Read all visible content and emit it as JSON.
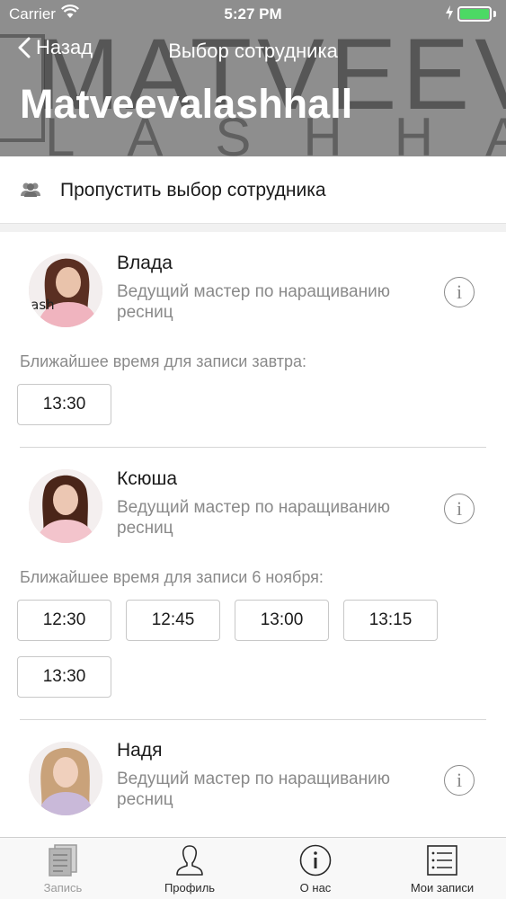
{
  "status_bar": {
    "carrier": "Carrier",
    "time": "5:27 PM"
  },
  "header": {
    "back_label": "Назад",
    "nav_title": "Выбор сотрудника",
    "title": "Matveevalashhall",
    "bg_logo_line1": "MATVEEV",
    "bg_logo_line2": "LASHHA"
  },
  "skip": {
    "label": "Пропустить выбор сотрудника",
    "icon": "group-icon"
  },
  "employees": [
    {
      "name": "Влада",
      "role": "Ведущий мастер по наращиванию ресниц",
      "slots_caption": "Ближайшее время для записи завтра:",
      "slots": [
        "13:30"
      ],
      "avatar_text": "lash"
    },
    {
      "name": "Ксюша",
      "role": "Ведущий мастер по наращиванию ресниц",
      "slots_caption": "Ближайшее время для записи 6 ноября:",
      "slots": [
        "12:30",
        "12:45",
        "13:00",
        "13:15",
        "13:30"
      ]
    },
    {
      "name": "Надя",
      "role": "Ведущий мастер по наращиванию ресниц"
    }
  ],
  "info_glyph": "i",
  "tabbar": {
    "items": [
      {
        "label": "Запись",
        "icon": "document-icon",
        "active": true
      },
      {
        "label": "Профиль",
        "icon": "person-icon",
        "active": false
      },
      {
        "label": "О нас",
        "icon": "info-icon",
        "active": false
      },
      {
        "label": "Мои записи",
        "icon": "list-icon",
        "active": false
      }
    ]
  },
  "colors": {
    "header_bg": "#8e8e8e",
    "battery": "#4cd964",
    "secondary_text": "#8a8a8a",
    "tab_inactive": "#9b9b9b"
  }
}
